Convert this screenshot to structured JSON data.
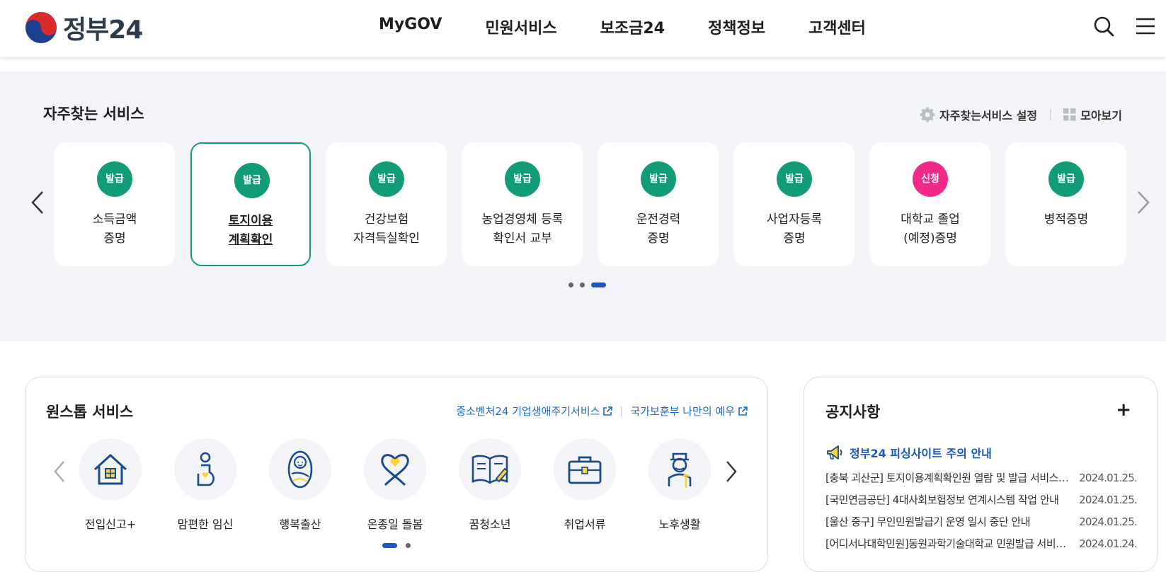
{
  "header": {
    "logo_text": "정부24",
    "nav": [
      "MyGOV",
      "민원서비스",
      "보조금24",
      "정책정보",
      "고객센터"
    ],
    "icons": [
      "search-icon",
      "menu-icon"
    ]
  },
  "frequent": {
    "title": "자주찾는 서비스",
    "settings_label": "자주찾는서비스 설정",
    "view_all_label": "모아보기",
    "cards": [
      {
        "badge": "발급",
        "label": "소득금액\n증명"
      },
      {
        "badge": "발급",
        "label": "토지이용\n계획확인"
      },
      {
        "badge": "발급",
        "label": "건강보험\n자격득실확인"
      },
      {
        "badge": "발급",
        "label": "농업경영체 등록\n확인서 교부"
      },
      {
        "badge": "발급",
        "label": "운전경력\n증명"
      },
      {
        "badge": "발급",
        "label": "사업자등록\n증명"
      },
      {
        "badge": "신청",
        "label": "대학교 졸업\n(예정)증명"
      },
      {
        "badge": "발급",
        "label": "병적증명"
      }
    ],
    "page_dots": 3,
    "active_dot": 3
  },
  "onestop": {
    "title": "원스톱 서비스",
    "link1": "중소벤처24 기업생애주기서비스",
    "link2": "국가보훈부 나만의 예우",
    "items": [
      {
        "label": "전입신고+",
        "icon": "house-icon"
      },
      {
        "label": "맘편한 임신",
        "icon": "pregnancy-icon"
      },
      {
        "label": "행복출산",
        "icon": "baby-icon"
      },
      {
        "label": "온종일 돌봄",
        "icon": "ribbon-heart-icon"
      },
      {
        "label": "꿈청소년",
        "icon": "book-icon"
      },
      {
        "label": "취업서류",
        "icon": "briefcase-icon"
      },
      {
        "label": "노후생활",
        "icon": "elder-icon"
      }
    ]
  },
  "notice": {
    "title": "공지사항",
    "plus": "+",
    "highlight": "정부24 피싱사이트 주의 안내",
    "items": [
      {
        "title": "[충북 괴산군] 토지이용계획확인원 열람 및 발급 서비스 일시 중단 안내",
        "date": "2024.01.25."
      },
      {
        "title": "[국민연금공단] 4대사회보험정보 연계시스템 작업 안내",
        "date": "2024.01.25."
      },
      {
        "title": "[울산 중구] 무인민원발급기 운영 일시 중단 안내",
        "date": "2024.01.25."
      },
      {
        "title": "[어디서나대학민원]동원과학기술대학교 민원발급 서비스 안내",
        "date": "2024.01.24."
      }
    ]
  },
  "colors": {
    "accent": "#119b76",
    "pink": "#f02a86",
    "link": "#1a6ad1",
    "background": "#f2f4f7"
  }
}
